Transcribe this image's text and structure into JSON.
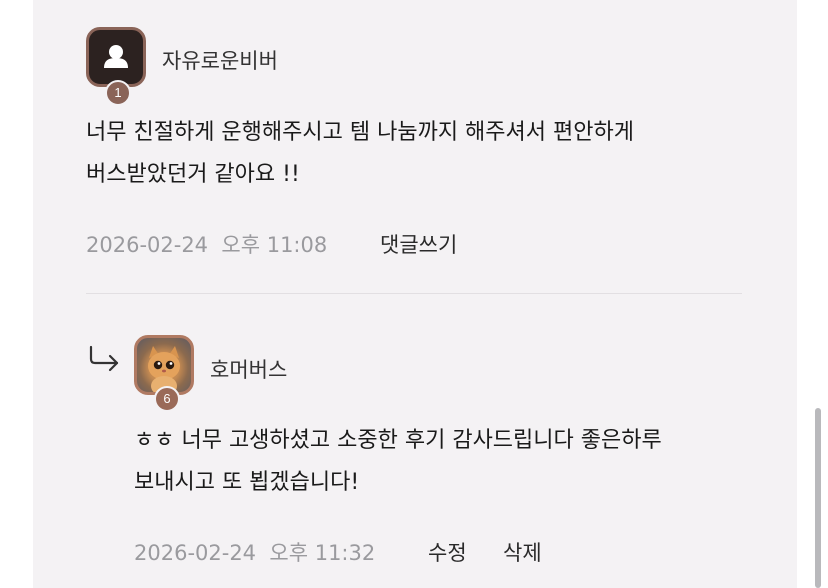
{
  "comments": [
    {
      "author": "자유로운비버",
      "level": "1",
      "text_line1": "너무 친절하게 운행해주시고 템 나눔까지 해주셔서 편안하게",
      "text_line2": "버스받았던거 같아요 !!",
      "timestamp": "2026-02-24  오후 11:08",
      "reply_label": "댓글쓰기",
      "avatar_icon": "user-silhouette-icon"
    }
  ],
  "reply": {
    "author": "호머버스",
    "level": "6",
    "text_line1": "ㅎㅎ 너무 고생하셨고 소중한 후기 감사드립니다 좋은하루",
    "text_line2": "보내시고 또 뵙겠습니다!",
    "timestamp": "2026-02-24  오후 11:32",
    "edit_label": "수정",
    "delete_label": "삭제",
    "indicator_icon": "reply-arrow-icon",
    "avatar_icon": "cat-avatar-image"
  },
  "colors": {
    "panel_bg": "#f4f2f4",
    "badge": "#8a6458",
    "meta_text": "#9a9a9e"
  }
}
